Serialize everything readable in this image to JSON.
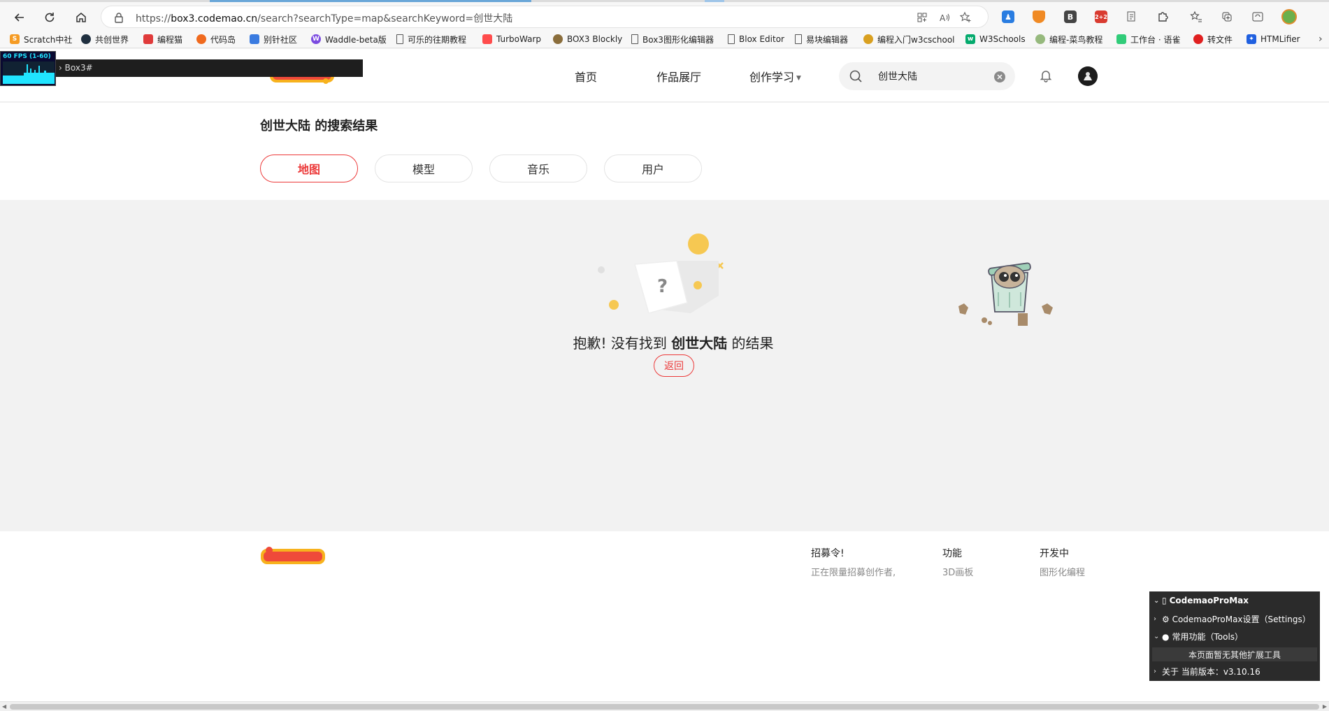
{
  "browser": {
    "url_prefix": "https://",
    "url_host": "box3.codemao.cn",
    "url_path": "/search?searchType=map&searchKeyword=创世大陆",
    "extensions": [
      {
        "icon": "person-icon",
        "color": "#2a7de1",
        "text": ""
      },
      {
        "icon": "shield-icon",
        "color": "#f08a24",
        "text": ""
      },
      {
        "icon": "b-icon",
        "color": "#444444",
        "text": "B"
      },
      {
        "icon": "badge-icon",
        "color": "#d93b30",
        "text": "2+2"
      },
      {
        "icon": "page-icon",
        "color": "#666666",
        "text": ""
      }
    ]
  },
  "bookmarks": [
    {
      "label": "Scratch中社",
      "icon": "scratch-icon",
      "color": "#f59b23"
    },
    {
      "label": "共创世界",
      "icon": "world-icon",
      "color": "#203040"
    },
    {
      "label": "编程猫",
      "icon": "cat-icon",
      "color": "#e03b3b"
    },
    {
      "label": "代码岛",
      "icon": "gear-icon",
      "color": "#f06a1e"
    },
    {
      "label": "别针社区",
      "icon": "hex-icon",
      "color": "#3a7be0"
    },
    {
      "label": "Waddle-beta版",
      "icon": "w-icon",
      "color": "#7b4be0"
    },
    {
      "label": "可乐的往期教程",
      "icon": "page-icon",
      "color": "#ffffff"
    },
    {
      "label": "TurboWarp",
      "icon": "turbowarp-icon",
      "color": "#ff4c4c"
    },
    {
      "label": "BOX3 Blockly",
      "icon": "blockly-icon",
      "color": "#8a6d3b"
    },
    {
      "label": "Box3图形化编辑器",
      "icon": "page-icon",
      "color": "#ffffff"
    },
    {
      "label": "Blox Editor",
      "icon": "page-icon",
      "color": "#ffffff"
    },
    {
      "label": "易块编辑器",
      "icon": "page-icon",
      "color": "#ffffff"
    },
    {
      "label": "编程入门w3cschool",
      "icon": "w3c-icon",
      "color": "#d9a020"
    },
    {
      "label": "W3Schools",
      "icon": "w3schools-icon",
      "color": "#04aa6d"
    },
    {
      "label": "编程-菜鸟教程",
      "icon": "runoob-icon",
      "color": "#96b97d"
    },
    {
      "label": "工作台 · 语雀",
      "icon": "yuque-icon",
      "color": "#31cc79"
    },
    {
      "label": "转文件",
      "icon": "convert-icon",
      "color": "#e02020"
    },
    {
      "label": "HTMLifier",
      "icon": "star-icon",
      "color": "#2060e0"
    }
  ],
  "header": {
    "nav": [
      "首页",
      "作品展厅",
      "创作学习"
    ],
    "search_value": "创世大陆"
  },
  "results": {
    "keyword": "创世大陆",
    "title_suffix": " 的搜索结果",
    "tabs": [
      "地图",
      "模型",
      "音乐",
      "用户"
    ],
    "active_tab": 0
  },
  "empty": {
    "prefix": "抱歉! 没有找到 ",
    "keyword": "创世大陆",
    "suffix": " 的结果",
    "back_label": "返回"
  },
  "footer": {
    "columns": [
      {
        "title": "招募令!",
        "item": "正在限量招募创作者,"
      },
      {
        "title": "功能",
        "item": "3D画板"
      },
      {
        "title": "开发中",
        "item": "图形化编程"
      }
    ]
  },
  "overlays": {
    "fps_label": "60 FPS (1-60)",
    "console_label": "Box3#",
    "cmpm_title": "CodemaoProMax",
    "cmpm_settings": "⚙ CodemaoProMax设置（Settings）",
    "cmpm_tools": "常用功能（Tools）",
    "cmpm_tools_empty": "本页面暂无其他扩展工具",
    "cmpm_version": "关于 当前版本：v3.10.16"
  },
  "colors": {
    "accent": "#ec3a3a",
    "page_bg": "#f2f2f2"
  }
}
